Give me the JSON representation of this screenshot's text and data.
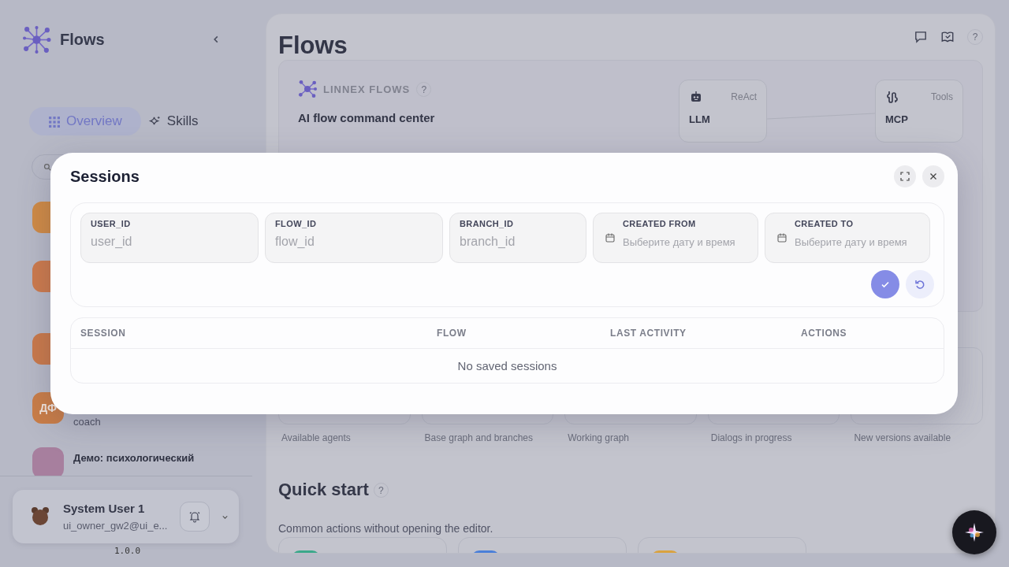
{
  "sidebar": {
    "brand": "Flows",
    "tabs": [
      {
        "label": "Overview",
        "selected": true
      },
      {
        "label": "Skills",
        "selected": false
      }
    ],
    "items": [
      {
        "color": "#cf8a45"
      },
      {
        "color": "#cc7a4c"
      },
      {
        "color": "#c9794a"
      },
      {
        "initials": "ДФ",
        "subtitle": "coach",
        "color": "#c97d47"
      },
      {
        "title": "Демо: психологический",
        "color": "#a77f9e"
      }
    ],
    "user": {
      "name": "System User 1",
      "email": "ui_owner_gw2@ui_e..."
    },
    "version": "1.0.0"
  },
  "main": {
    "title": "Flows",
    "help": "?",
    "hero": {
      "brand": "LINNEX FLOWS",
      "help": "?",
      "headline": "AI flow command center",
      "nodes": [
        {
          "tag": "ReAct",
          "label": "LLM"
        },
        {
          "tag": "Tools",
          "label": "MCP"
        }
      ]
    },
    "stats": [
      "Available agents",
      "Base graph and branches",
      "Working graph",
      "Dialogs in progress",
      "New versions available"
    ],
    "quick_start": {
      "title": "Quick start",
      "help": "?",
      "subtitle": "Common actions without opening the editor.",
      "actions": [
        {
          "color": "#3aa88a"
        },
        {
          "color": "#4a7fd9"
        },
        {
          "color": "#d9a23f"
        }
      ]
    }
  },
  "modal": {
    "title": "Sessions",
    "filters": [
      {
        "kind": "text",
        "label": "USER_ID",
        "placeholder": "user_id"
      },
      {
        "kind": "text",
        "label": "FLOW_ID",
        "placeholder": "flow_id"
      },
      {
        "kind": "text",
        "label": "BRANCH_ID",
        "placeholder": "branch_id"
      },
      {
        "kind": "date",
        "label": "CREATED FROM",
        "placeholder": "Выберите дату и время"
      },
      {
        "kind": "date",
        "label": "CREATED TO",
        "placeholder": "Выберите дату и время"
      }
    ],
    "columns": [
      "SESSION",
      "FLOW",
      "LAST ACTIVITY",
      "ACTIONS"
    ],
    "empty": "No saved sessions"
  }
}
